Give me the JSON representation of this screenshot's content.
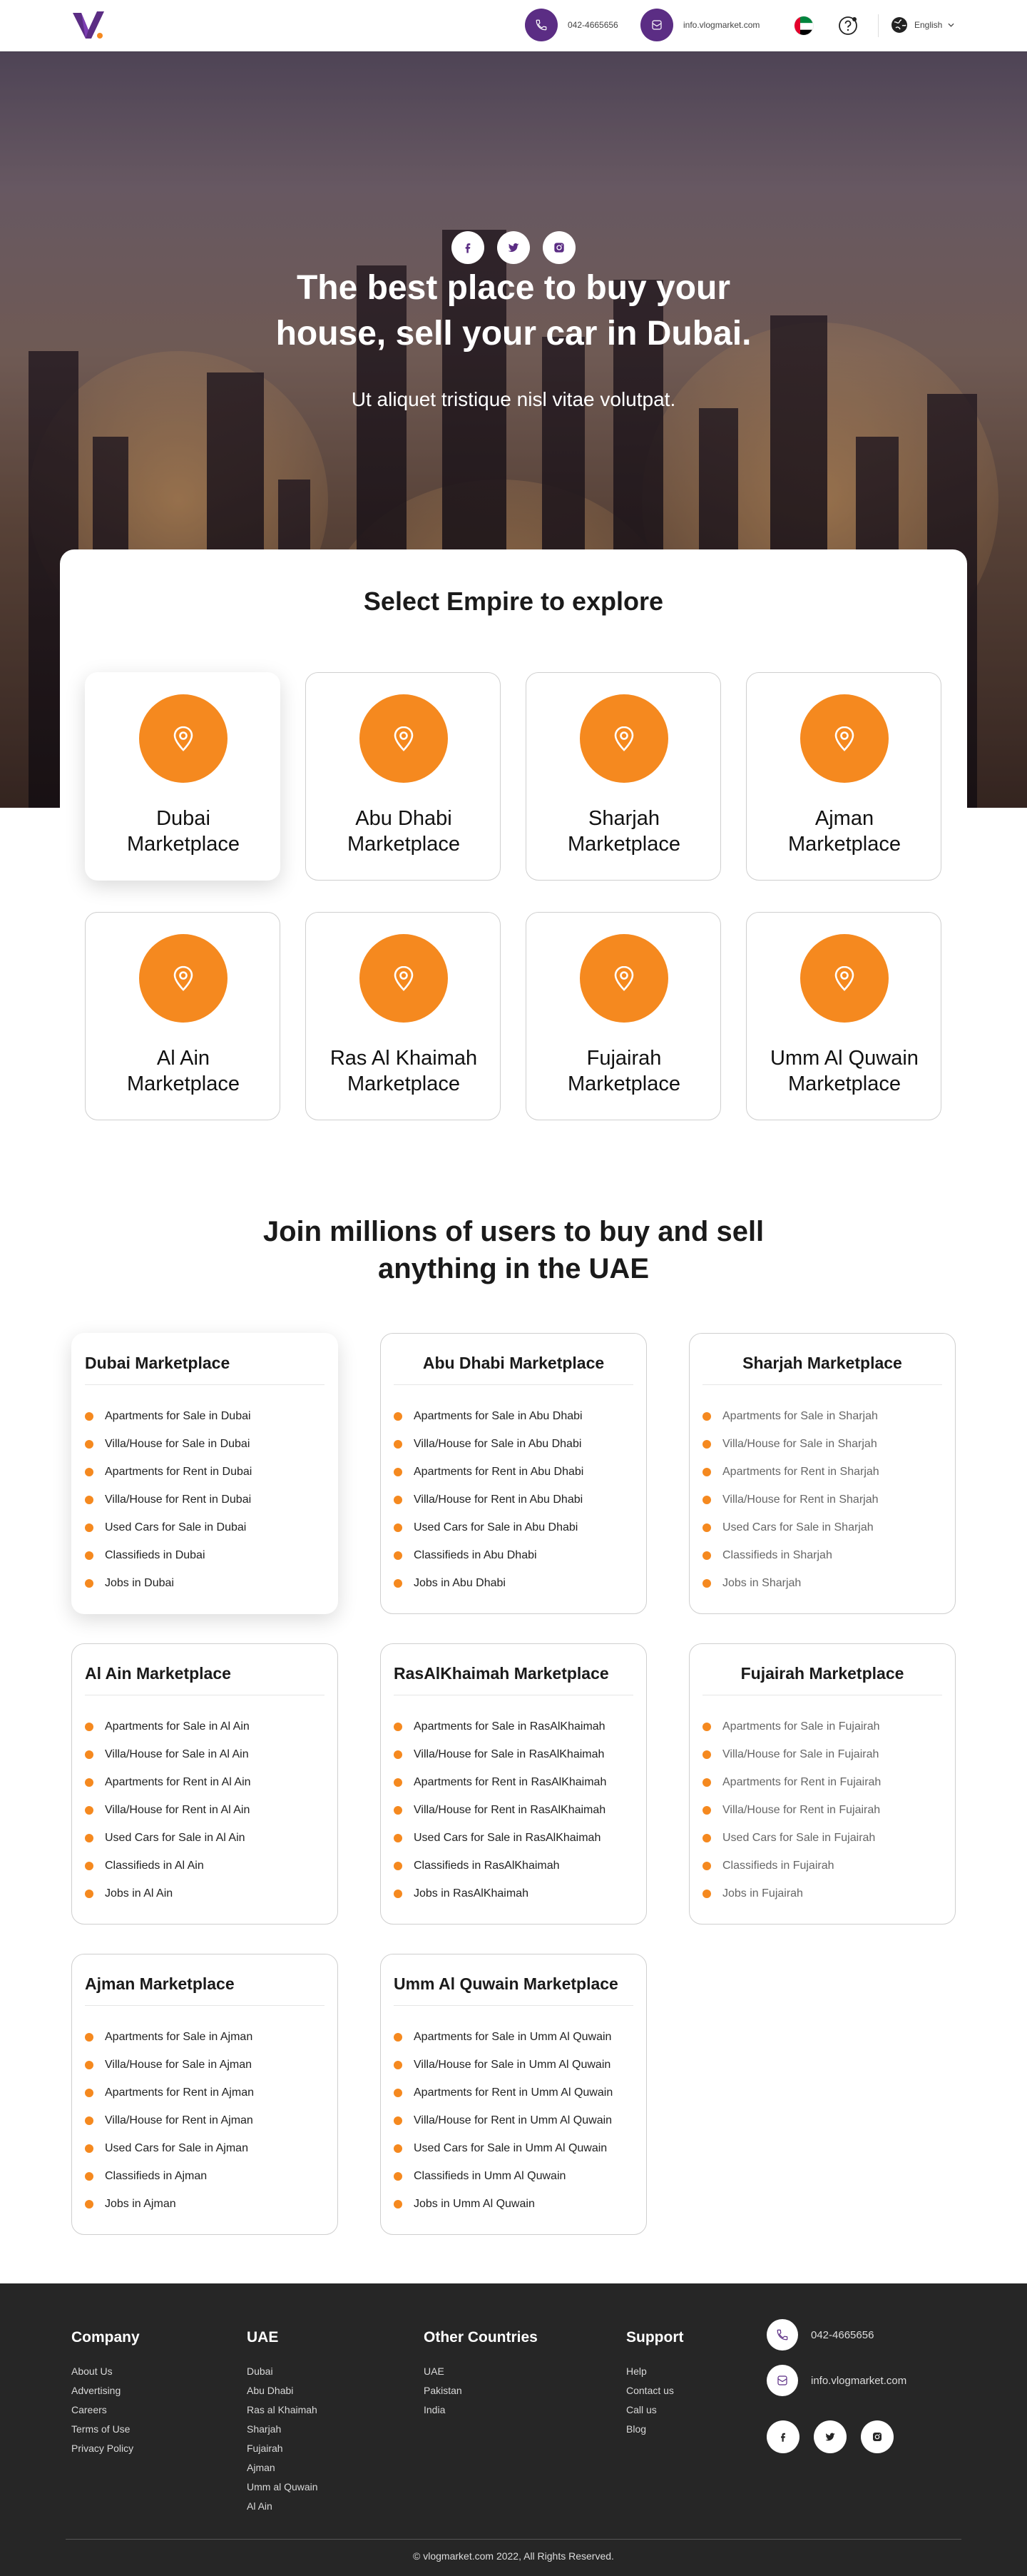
{
  "header": {
    "phone": "042-4665656",
    "email": "info.vlogmarket.com",
    "language": "English"
  },
  "hero": {
    "title_line1": "The best place to buy your",
    "title_line2": "house, sell your car in Dubai.",
    "subtitle": "Ut aliquet tristique nisl vitae volutpat."
  },
  "empire": {
    "title": "Select Empire to explore",
    "cards": [
      {
        "line1": "Dubai",
        "line2": "Marketplace"
      },
      {
        "line1": "Abu Dhabi",
        "line2": "Marketplace"
      },
      {
        "line1": "Sharjah",
        "line2": "Marketplace"
      },
      {
        "line1": "Ajman",
        "line2": "Marketplace"
      },
      {
        "line1": "Al Ain",
        "line2": "Marketplace"
      },
      {
        "line1": "Ras Al Khaimah",
        "line2": "Marketplace"
      },
      {
        "line1": "Fujairah",
        "line2": "Marketplace"
      },
      {
        "line1": "Umm Al Quwain",
        "line2": "Marketplace"
      }
    ]
  },
  "join": {
    "title_line1": "Join millions of users to buy and sell",
    "title_line2": "anything in the UAE",
    "cards": [
      {
        "title": "Dubai Marketplace",
        "items": [
          "Apartments for Sale in Dubai",
          "Villa/House for Sale in Dubai",
          "Apartments for Rent in Dubai",
          "Villa/House for Rent in Dubai",
          "Used Cars for Sale in Dubai",
          "Classifieds in Dubai",
          "Jobs in Dubai"
        ]
      },
      {
        "title": "Abu Dhabi Marketplace",
        "items": [
          "Apartments for Sale in Abu Dhabi",
          "Villa/House for Sale in Abu Dhabi",
          "Apartments for Rent in Abu Dhabi",
          "Villa/House for Rent in Abu Dhabi",
          "Used Cars for Sale in Abu Dhabi",
          "Classifieds in Abu Dhabi",
          "Jobs in Abu Dhabi"
        ]
      },
      {
        "title": "Sharjah Marketplace",
        "items": [
          "Apartments for Sale in Sharjah",
          "Villa/House for Sale in Sharjah",
          "Apartments for Rent in Sharjah",
          "Villa/House for Rent in Sharjah",
          "Used Cars for Sale in Sharjah",
          "Classifieds in Sharjah",
          "Jobs in Sharjah"
        ]
      },
      {
        "title": "Al Ain Marketplace",
        "items": [
          "Apartments for Sale in Al Ain",
          "Villa/House for Sale in Al Ain",
          "Apartments for Rent in Al Ain",
          "Villa/House for Rent in Al Ain",
          "Used Cars for Sale in Al Ain",
          "Classifieds in Al Ain",
          "Jobs in Al Ain"
        ]
      },
      {
        "title": "RasAlKhaimah Marketplace",
        "items": [
          "Apartments for Sale in RasAlKhaimah",
          "Villa/House for Sale in RasAlKhaimah",
          "Apartments for Rent in RasAlKhaimah",
          "Villa/House for Rent in RasAlKhaimah",
          "Used Cars for Sale in RasAlKhaimah",
          "Classifieds in RasAlKhaimah",
          "Jobs in RasAlKhaimah"
        ]
      },
      {
        "title": "Fujairah Marketplace",
        "items": [
          "Apartments for Sale in Fujairah",
          "Villa/House for Sale in Fujairah",
          "Apartments for Rent in Fujairah",
          "Villa/House for Rent in Fujairah",
          "Used Cars for Sale in Fujairah",
          "Classifieds in Fujairah",
          "Jobs in Fujairah"
        ]
      },
      {
        "title": "Ajman Marketplace",
        "items": [
          "Apartments for Sale in Ajman",
          "Villa/House for Sale in Ajman",
          "Apartments for Rent in Ajman",
          "Villa/House for Rent in Ajman",
          "Used Cars for Sale in Ajman",
          "Classifieds in Ajman",
          "Jobs in Ajman"
        ]
      },
      {
        "title": "Umm Al Quwain Marketplace",
        "items": [
          "Apartments for Sale in  Umm Al Quwain",
          "Villa/House for Sale in Umm Al Quwain",
          "Apartments for Rent in Umm Al Quwain",
          "Villa/House for Rent in Umm Al Quwain",
          "Used Cars for Sale in Umm Al Quwain",
          "Classifieds in Umm Al Quwain",
          "Jobs in Umm Al Quwain"
        ]
      }
    ]
  },
  "footer": {
    "company": {
      "title": "Company",
      "links": [
        "About Us",
        "Advertising",
        "Careers",
        "Terms of Use",
        "Privacy Policy"
      ]
    },
    "uae": {
      "title": "UAE",
      "links": [
        "Dubai",
        "Abu Dhabi",
        "Ras al Khaimah",
        "Sharjah",
        "Fujairah",
        "Ajman",
        "Umm al Quwain",
        "Al Ain"
      ]
    },
    "other": {
      "title": "Other Countries",
      "links": [
        "UAE",
        "Pakistan",
        "India"
      ]
    },
    "support": {
      "title": "Support",
      "links": [
        "Help",
        "Contact us",
        "Call us",
        "Blog"
      ]
    },
    "phone": "042-4665656",
    "email": "info.vlogmarket.com",
    "copyright": "© vlogmarket.com 2022, All Rights Reserved."
  },
  "colors": {
    "brand_purple": "#5b2d84",
    "accent_orange": "#f5891f",
    "footer_bg": "#262626"
  }
}
